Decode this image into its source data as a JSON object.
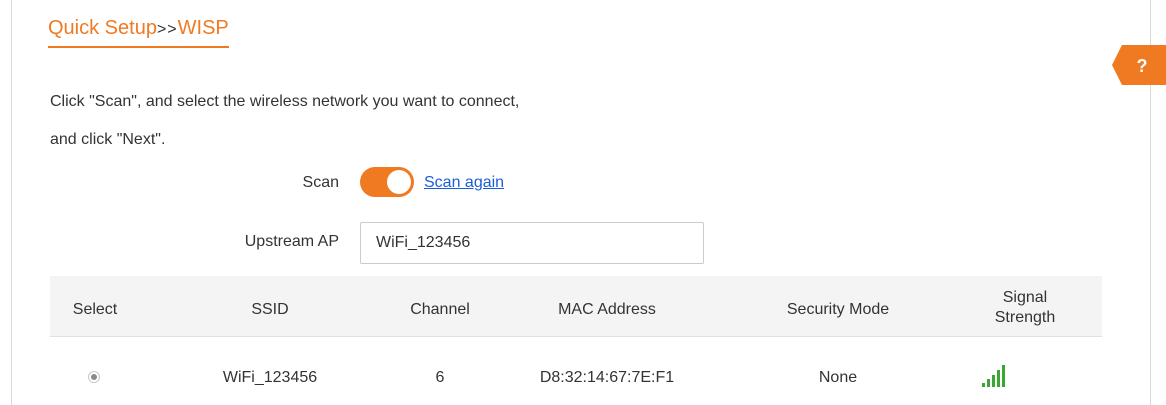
{
  "header": {
    "title_part1": "Quick Setup",
    "title_separator": ">>",
    "title_part2": "WISP"
  },
  "help": {
    "label": "?"
  },
  "instructions": {
    "line1": "Click \"Scan\", and select the wireless network you want to connect,",
    "line2": "and click \"Next\"."
  },
  "scan": {
    "label": "Scan",
    "enabled": true,
    "link_label": "Scan again"
  },
  "upstream_ap": {
    "label": "Upstream AP",
    "value": "WiFi_123456"
  },
  "table": {
    "headers": {
      "select": "Select",
      "ssid": "SSID",
      "channel": "Channel",
      "mac": "MAC Address",
      "security": "Security Mode",
      "signal_line1": "Signal",
      "signal_line2": "Strength"
    },
    "rows": [
      {
        "selected": true,
        "ssid": "WiFi_123456",
        "channel": "6",
        "mac": "D8:32:14:67:7E:F1",
        "security": "None",
        "signal_icon": "signal-bars-icon",
        "signal_level": 5
      }
    ]
  },
  "colors": {
    "accent": "#f07a22",
    "link": "#1a5fd6",
    "signal": "#3aa82e"
  }
}
